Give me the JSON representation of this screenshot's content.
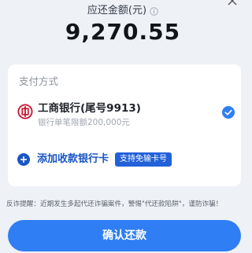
{
  "header": {
    "amount_label": "应还金额(元)",
    "amount_value": "9,270.55"
  },
  "payment": {
    "section_title": "支付方式",
    "bank_name": "工商银行(尾号9913)",
    "bank_limit": "银行单笔限额200,000元",
    "add_card_label": "添加收款银行卡",
    "no_card_badge": "支持免输卡号"
  },
  "warning_text": "反诈提醒：近期发生多起代还诈骗案件，警惕\"代还款陷阱\"，谨防诈骗！",
  "confirm_button_label": "确认还款",
  "colors": {
    "accent": "#2f7ef3",
    "link": "#1a56c4",
    "bank_red": "#c8102e",
    "background": "#eef1f6"
  },
  "icons": {
    "close": "close-icon",
    "info": "info-icon",
    "bank_logo": "icbc-logo-icon",
    "check": "check-circle-icon",
    "plus": "plus-circle-icon"
  }
}
